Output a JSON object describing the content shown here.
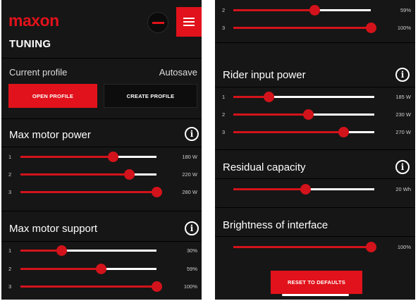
{
  "header": {
    "logo_text": "maxon",
    "screen_title": "TUNING",
    "menu_icon": "hamburger-menu-icon",
    "avatar_icon": "profile-avatar-icon"
  },
  "profile": {
    "label": "Current profile",
    "status": "Autosave",
    "open_button": "OPEN PROFILE",
    "create_button": "CREATE PROFILE"
  },
  "sections": {
    "max_motor_power": {
      "title": "Max motor power",
      "info_icon": "i",
      "rows": [
        {
          "index": "1",
          "value": "180 W",
          "level": 0.68
        },
        {
          "index": "2",
          "value": "220 W",
          "level": 0.8
        },
        {
          "index": "3",
          "value": "280 W",
          "level": 1.0
        }
      ]
    },
    "max_motor_support": {
      "title": "Max motor support",
      "info_icon": "i",
      "rows": [
        {
          "index": "1",
          "value": "30%",
          "level": 0.3
        },
        {
          "index": "2",
          "value": "59%",
          "level": 0.59
        },
        {
          "index": "3",
          "value": "100%",
          "level": 1.0
        }
      ]
    },
    "support_continued": {
      "rows": [
        {
          "index": "2",
          "value": "59%",
          "level": 0.59
        },
        {
          "index": "3",
          "value": "100%",
          "level": 1.0
        }
      ]
    },
    "rider_input_power": {
      "title": "Rider input power",
      "info_icon": "i",
      "rows": [
        {
          "index": "1",
          "value": "185 W",
          "level": 0.25
        },
        {
          "index": "2",
          "value": "230 W",
          "level": 0.53
        },
        {
          "index": "3",
          "value": "270 W",
          "level": 0.78
        }
      ]
    },
    "residual_capacity": {
      "title": "Residual capacity",
      "info_icon": "i",
      "value": "20 Wh",
      "level": 0.51
    },
    "brightness": {
      "title": "Brightness of interface",
      "value": "100%",
      "level": 1.0
    }
  },
  "reset_button": "RESET TO DEFAULTS",
  "colors": {
    "accent": "#e1121b",
    "background": "#161616",
    "track": "#ffffff"
  }
}
